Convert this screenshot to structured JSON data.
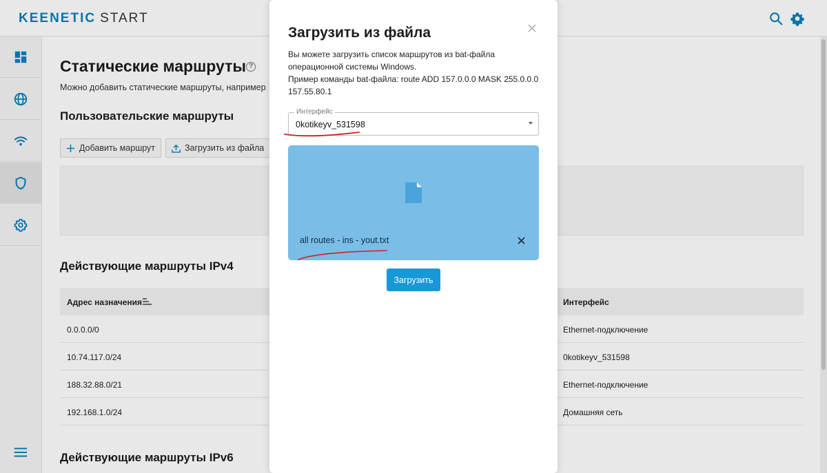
{
  "app": {
    "logo_brand": "KEENETIC",
    "logo_suffix": "START"
  },
  "page": {
    "title": "Статические маршруты",
    "description": "Можно добавить статические маршруты, например, к л",
    "user_routes_title": "Пользовательские маршруты",
    "add_route_label": "Добавить маршрут",
    "upload_file_label": "Загрузить из файла",
    "ipv4_title": "Действующие маршруты IPv4",
    "ipv6_title": "Действующие маршруты IPv6"
  },
  "table": {
    "headers": {
      "destination": "Адрес назначения",
      "interface": "Интерфейс"
    },
    "rows": [
      {
        "destination": "0.0.0.0/0",
        "interface": "Ethernet-подключение"
      },
      {
        "destination": "10.74.117.0/24",
        "interface": "0kotikeyv_531598"
      },
      {
        "destination": "188.32.88.0/21",
        "interface": "Ethernet-подключение"
      },
      {
        "destination": "192.168.1.0/24",
        "interface": "Домашняя сеть"
      }
    ]
  },
  "modal": {
    "title": "Загрузить из файла",
    "desc_line1": "Вы можете загрузить список маршрутов из bat-файла",
    "desc_line2": "операционной системы Windows.",
    "desc_line3": "Пример команды bat-файла: route ADD 157.0.0.0 MASK 255.0.0.0",
    "desc_line4": "157.55.80.1",
    "interface_label": "Интерфейс",
    "interface_value": "0kotikeyv_531598",
    "file_name": "all routes - ins - yout.txt",
    "upload_button": "Загрузить"
  },
  "colors": {
    "accent": "#1898d7",
    "dropzone": "#7abde6",
    "annotation": "#d02020"
  }
}
